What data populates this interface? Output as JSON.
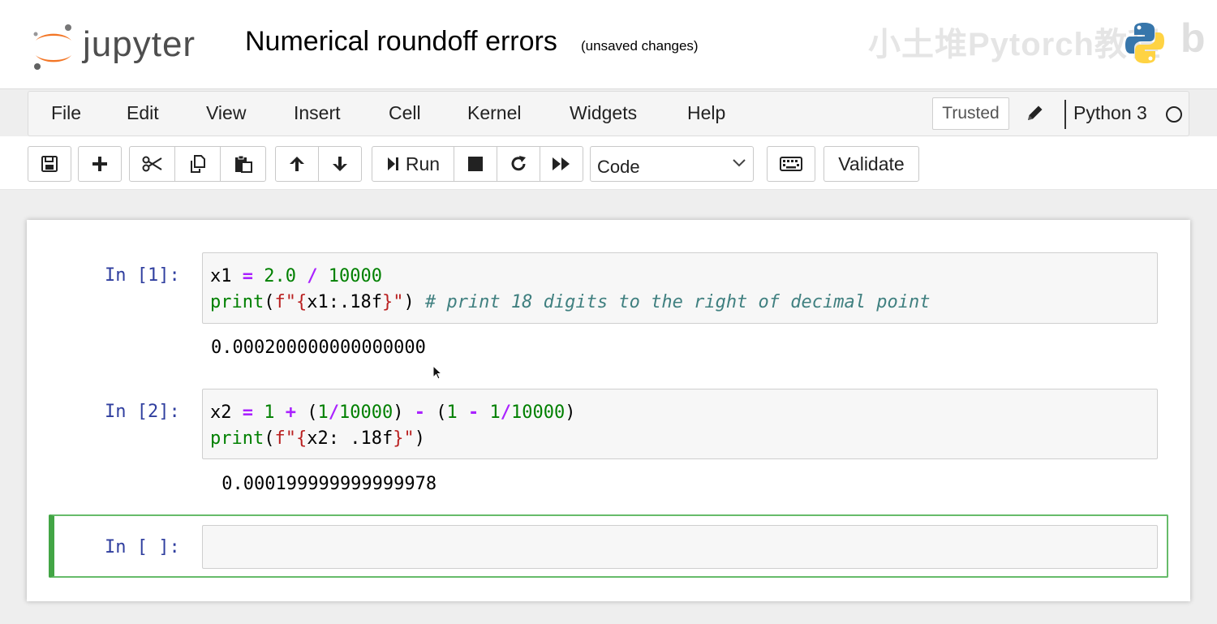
{
  "header": {
    "logo_text": "jupyter",
    "notebook_title": "Numerical roundoff errors",
    "save_status": "(unsaved changes)",
    "watermark": "小土堆Pytorch教程",
    "watermark_right": "b"
  },
  "menubar": {
    "items": [
      "File",
      "Edit",
      "View",
      "Insert",
      "Cell",
      "Kernel",
      "Widgets",
      "Help"
    ],
    "trusted_label": "Trusted",
    "kernel_name": "Python 3"
  },
  "toolbar": {
    "run_label": "Run",
    "cell_type": "Code",
    "validate_label": "Validate"
  },
  "cells": [
    {
      "prompt": "In [1]:",
      "code": [
        "x1 = 2.0 / 10000",
        "print(f\"{x1:.18f}\") # print 18 digits to the right of decimal point"
      ],
      "output": "0.000200000000000000"
    },
    {
      "prompt": "In [2]:",
      "code": [
        "x2 = 1 + (1/10000) - (1 - 1/10000)",
        "print(f\"{x2: .18f}\")"
      ],
      "output": " 0.000199999999999978"
    },
    {
      "prompt": "In [ ]:",
      "code": [],
      "output": ""
    }
  ],
  "colors": {
    "prompt": "#303f9f",
    "active_border": "#42a545",
    "keyword": "#008000",
    "operator": "#aa22ff",
    "string": "#ba2121",
    "comment": "#408080"
  }
}
